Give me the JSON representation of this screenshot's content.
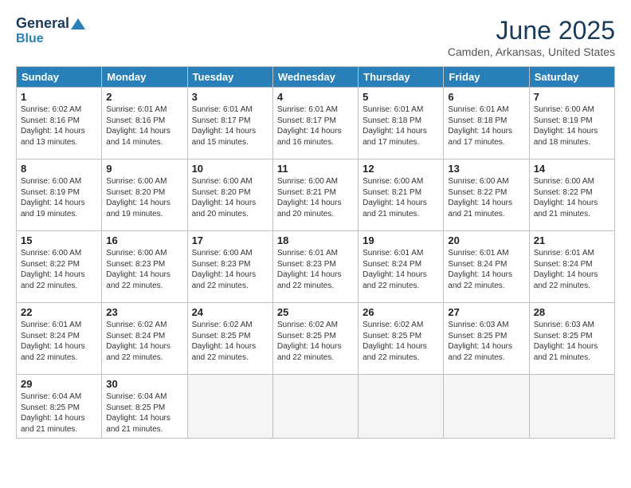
{
  "header": {
    "logo_line1": "General",
    "logo_line2": "Blue",
    "month_title": "June 2025",
    "location": "Camden, Arkansas, United States"
  },
  "calendar": {
    "days_of_week": [
      "Sunday",
      "Monday",
      "Tuesday",
      "Wednesday",
      "Thursday",
      "Friday",
      "Saturday"
    ],
    "weeks": [
      [
        {
          "day": "1",
          "info": "Sunrise: 6:02 AM\nSunset: 8:16 PM\nDaylight: 14 hours\nand 13 minutes."
        },
        {
          "day": "2",
          "info": "Sunrise: 6:01 AM\nSunset: 8:16 PM\nDaylight: 14 hours\nand 14 minutes."
        },
        {
          "day": "3",
          "info": "Sunrise: 6:01 AM\nSunset: 8:17 PM\nDaylight: 14 hours\nand 15 minutes."
        },
        {
          "day": "4",
          "info": "Sunrise: 6:01 AM\nSunset: 8:17 PM\nDaylight: 14 hours\nand 16 minutes."
        },
        {
          "day": "5",
          "info": "Sunrise: 6:01 AM\nSunset: 8:18 PM\nDaylight: 14 hours\nand 17 minutes."
        },
        {
          "day": "6",
          "info": "Sunrise: 6:01 AM\nSunset: 8:18 PM\nDaylight: 14 hours\nand 17 minutes."
        },
        {
          "day": "7",
          "info": "Sunrise: 6:00 AM\nSunset: 8:19 PM\nDaylight: 14 hours\nand 18 minutes."
        }
      ],
      [
        {
          "day": "8",
          "info": "Sunrise: 6:00 AM\nSunset: 8:19 PM\nDaylight: 14 hours\nand 19 minutes."
        },
        {
          "day": "9",
          "info": "Sunrise: 6:00 AM\nSunset: 8:20 PM\nDaylight: 14 hours\nand 19 minutes."
        },
        {
          "day": "10",
          "info": "Sunrise: 6:00 AM\nSunset: 8:20 PM\nDaylight: 14 hours\nand 20 minutes."
        },
        {
          "day": "11",
          "info": "Sunrise: 6:00 AM\nSunset: 8:21 PM\nDaylight: 14 hours\nand 20 minutes."
        },
        {
          "day": "12",
          "info": "Sunrise: 6:00 AM\nSunset: 8:21 PM\nDaylight: 14 hours\nand 21 minutes."
        },
        {
          "day": "13",
          "info": "Sunrise: 6:00 AM\nSunset: 8:22 PM\nDaylight: 14 hours\nand 21 minutes."
        },
        {
          "day": "14",
          "info": "Sunrise: 6:00 AM\nSunset: 8:22 PM\nDaylight: 14 hours\nand 21 minutes."
        }
      ],
      [
        {
          "day": "15",
          "info": "Sunrise: 6:00 AM\nSunset: 8:22 PM\nDaylight: 14 hours\nand 22 minutes."
        },
        {
          "day": "16",
          "info": "Sunrise: 6:00 AM\nSunset: 8:23 PM\nDaylight: 14 hours\nand 22 minutes."
        },
        {
          "day": "17",
          "info": "Sunrise: 6:00 AM\nSunset: 8:23 PM\nDaylight: 14 hours\nand 22 minutes."
        },
        {
          "day": "18",
          "info": "Sunrise: 6:01 AM\nSunset: 8:23 PM\nDaylight: 14 hours\nand 22 minutes."
        },
        {
          "day": "19",
          "info": "Sunrise: 6:01 AM\nSunset: 8:24 PM\nDaylight: 14 hours\nand 22 minutes."
        },
        {
          "day": "20",
          "info": "Sunrise: 6:01 AM\nSunset: 8:24 PM\nDaylight: 14 hours\nand 22 minutes."
        },
        {
          "day": "21",
          "info": "Sunrise: 6:01 AM\nSunset: 8:24 PM\nDaylight: 14 hours\nand 22 minutes."
        }
      ],
      [
        {
          "day": "22",
          "info": "Sunrise: 6:01 AM\nSunset: 8:24 PM\nDaylight: 14 hours\nand 22 minutes."
        },
        {
          "day": "23",
          "info": "Sunrise: 6:02 AM\nSunset: 8:24 PM\nDaylight: 14 hours\nand 22 minutes."
        },
        {
          "day": "24",
          "info": "Sunrise: 6:02 AM\nSunset: 8:25 PM\nDaylight: 14 hours\nand 22 minutes."
        },
        {
          "day": "25",
          "info": "Sunrise: 6:02 AM\nSunset: 8:25 PM\nDaylight: 14 hours\nand 22 minutes."
        },
        {
          "day": "26",
          "info": "Sunrise: 6:02 AM\nSunset: 8:25 PM\nDaylight: 14 hours\nand 22 minutes."
        },
        {
          "day": "27",
          "info": "Sunrise: 6:03 AM\nSunset: 8:25 PM\nDaylight: 14 hours\nand 22 minutes."
        },
        {
          "day": "28",
          "info": "Sunrise: 6:03 AM\nSunset: 8:25 PM\nDaylight: 14 hours\nand 21 minutes."
        }
      ],
      [
        {
          "day": "29",
          "info": "Sunrise: 6:04 AM\nSunset: 8:25 PM\nDaylight: 14 hours\nand 21 minutes."
        },
        {
          "day": "30",
          "info": "Sunrise: 6:04 AM\nSunset: 8:25 PM\nDaylight: 14 hours\nand 21 minutes."
        },
        {
          "day": "",
          "info": ""
        },
        {
          "day": "",
          "info": ""
        },
        {
          "day": "",
          "info": ""
        },
        {
          "day": "",
          "info": ""
        },
        {
          "day": "",
          "info": ""
        }
      ]
    ]
  }
}
